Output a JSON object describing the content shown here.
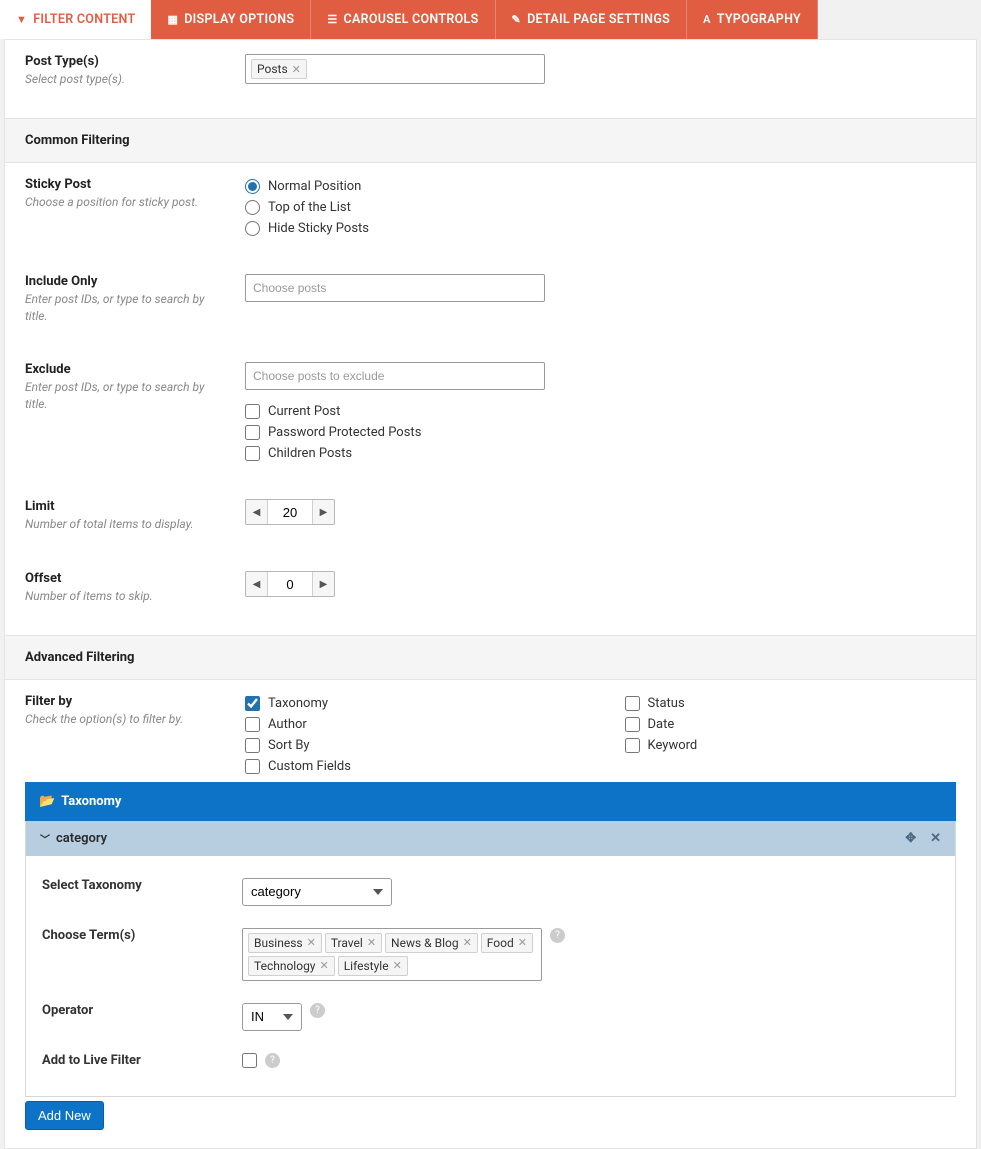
{
  "tabs": {
    "filter_content": "FILTER CONTENT",
    "display_options": "DISPLAY OPTIONS",
    "carousel_controls": "CAROUSEL CONTROLS",
    "detail_page_settings": "DETAIL PAGE SETTINGS",
    "typography": "TYPOGRAPHY"
  },
  "post_types": {
    "label": "Post Type(s)",
    "desc": "Select post type(s).",
    "selected": [
      "Posts"
    ]
  },
  "section_common": "Common Filtering",
  "sticky": {
    "label": "Sticky Post",
    "desc": "Choose a position for sticky post.",
    "options": [
      "Normal Position",
      "Top of the List",
      "Hide Sticky Posts"
    ],
    "selected": 0
  },
  "include": {
    "label": "Include Only",
    "desc": "Enter post IDs, or type to search by title.",
    "placeholder": "Choose posts"
  },
  "exclude": {
    "label": "Exclude",
    "desc": "Enter post IDs, or type to search by title.",
    "placeholder": "Choose posts to exclude",
    "options": [
      "Current Post",
      "Password Protected Posts",
      "Children Posts"
    ]
  },
  "limit": {
    "label": "Limit",
    "desc": "Number of total items to display.",
    "value": "20"
  },
  "offset": {
    "label": "Offset",
    "desc": "Number of items to skip.",
    "value": "0"
  },
  "section_advanced": "Advanced Filtering",
  "filter_by": {
    "label": "Filter by",
    "desc": "Check the option(s) to filter by.",
    "left": [
      "Taxonomy",
      "Author",
      "Sort By",
      "Custom Fields"
    ],
    "right": [
      "Status",
      "Date",
      "Keyword"
    ],
    "checked": [
      "Taxonomy"
    ]
  },
  "taxonomy_accordion": {
    "title": "Taxonomy",
    "term_header": "category",
    "select_taxonomy_label": "Select Taxonomy",
    "select_taxonomy_value": "category",
    "choose_terms_label": "Choose Term(s)",
    "terms": [
      "Business",
      "Travel",
      "News & Blog",
      "Food",
      "Technology",
      "Lifestyle"
    ],
    "operator_label": "Operator",
    "operator_value": "IN",
    "live_filter_label": "Add to Live Filter",
    "add_new": "Add New"
  }
}
